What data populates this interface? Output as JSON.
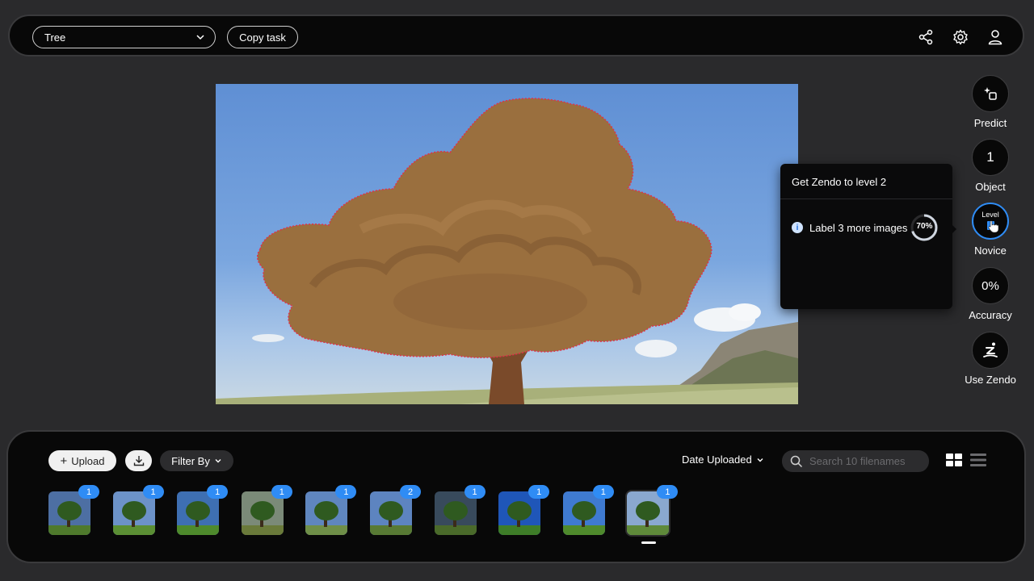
{
  "toolbar": {
    "task_value": "Tree",
    "copy_task_label": "Copy task"
  },
  "rail": {
    "predict_label": "Predict",
    "object_count": "1",
    "object_label": "Object",
    "level_badge": "Level",
    "level_label": "Novice",
    "accuracy_value": "0%",
    "accuracy_label": "Accuracy",
    "use_zendo_label": "Use Zendo"
  },
  "popup": {
    "title": "Get Zendo to level 2",
    "task_text": "Label 3 more images",
    "progress_text": "70%",
    "progress": 0.7
  },
  "gallery": {
    "upload_label": "Upload",
    "filter_label": "Filter By",
    "sort_label": "Date Uploaded",
    "search_placeholder": "Search 10 filenames",
    "thumbnails": [
      {
        "count": "1"
      },
      {
        "count": "1"
      },
      {
        "count": "1"
      },
      {
        "count": "1"
      },
      {
        "count": "1"
      },
      {
        "count": "2"
      },
      {
        "count": "1"
      },
      {
        "count": "1"
      },
      {
        "count": "1"
      },
      {
        "count": "1"
      }
    ]
  },
  "colors": {
    "accent": "#2f8cf5",
    "mask_outline": "#e0304a",
    "panel": "#080808",
    "background": "#2a2a2c"
  },
  "icons": [
    "chevron-down-icon",
    "share-icon",
    "gear-icon",
    "user-icon",
    "predict-sparkle-icon",
    "cursor-icon",
    "zendo-logo-icon",
    "plus-icon",
    "download-icon",
    "search-icon",
    "grid-view-icon",
    "list-view-icon",
    "info-icon"
  ]
}
